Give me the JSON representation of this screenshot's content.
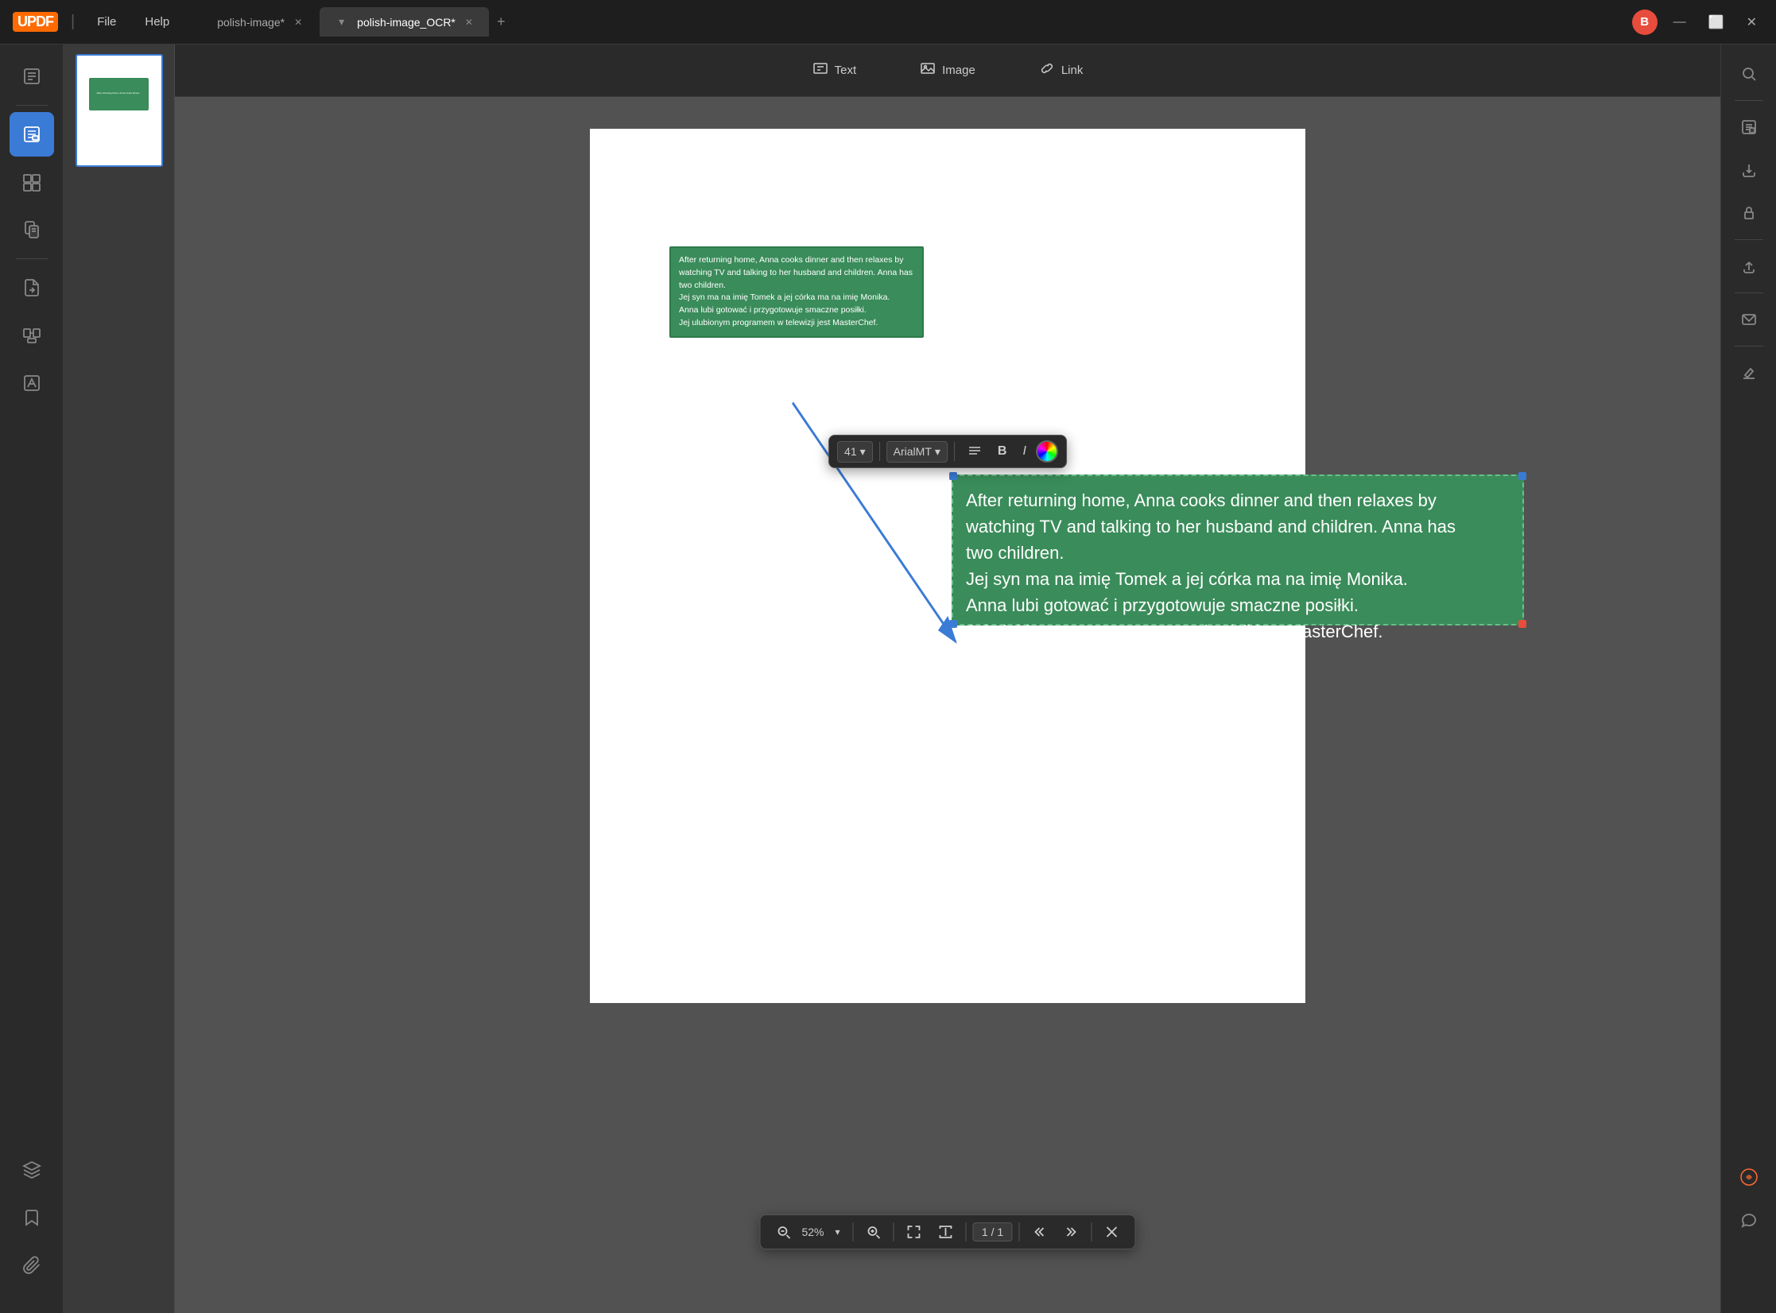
{
  "app": {
    "logo": "UPDF",
    "menus": [
      "File",
      "Help"
    ]
  },
  "tabs": [
    {
      "id": "tab1",
      "label": "polish-image*",
      "active": false
    },
    {
      "id": "tab2",
      "label": "polish-image_OCR*",
      "active": true
    }
  ],
  "tab_add_label": "+",
  "titlebar": {
    "minimize": "—",
    "maximize": "⬜",
    "close": "✕"
  },
  "toolbar": {
    "text_label": "Text",
    "image_label": "Image",
    "link_label": "Link"
  },
  "preview_text": {
    "line1": "After returning home, Anna cooks dinner and then relaxes by",
    "line2": "watching TV and talking to her husband and children. Anna has",
    "line3": "two children.",
    "line4": "Jej syn ma na imię Tomek a jej córka ma na imię Monika.",
    "line5": "Anna lubi gotować i przygotowuje smaczne posiłki.",
    "line6": "Jej ulubionym programem w telewizji jest MasterChef."
  },
  "main_text": {
    "line1": "After returning home, Anna cooks dinner and then relaxes by",
    "line2": "watching TV and talking to her husband and children. Anna has",
    "line3": "two children.",
    "line4": "Jej syn ma na imię Tomek a jej córka ma na imię Monika.",
    "line5": "Anna lubi gotować i przygotowuje smaczne posiłki.",
    "line6": "Jej ulubionym programem w telewizji jest MasterChef."
  },
  "format_toolbar": {
    "font_size": "41",
    "font_name": "ArialMT",
    "align_icon": "≡",
    "bold_label": "B",
    "italic_label": "I"
  },
  "bottom_toolbar": {
    "zoom_level": "52%",
    "page_current": "1",
    "page_total": "1",
    "page_display": "1 / 1"
  },
  "sidebar_left": {
    "icons": [
      {
        "name": "reader-icon",
        "symbol": "📄",
        "active": false
      },
      {
        "name": "edit-icon",
        "symbol": "✏️",
        "active": true
      },
      {
        "name": "page-layout-icon",
        "symbol": "⊞",
        "active": false
      },
      {
        "name": "ocr-icon",
        "symbol": "⊡",
        "active": false
      },
      {
        "name": "extract-icon",
        "symbol": "↗",
        "active": false
      },
      {
        "name": "compress-icon",
        "symbol": "⊟",
        "active": false
      },
      {
        "name": "watermark-icon",
        "symbol": "◫",
        "active": false
      }
    ]
  },
  "sidebar_right": {
    "icons": [
      {
        "name": "search-icon",
        "symbol": "🔍"
      },
      {
        "name": "ocr-panel-icon",
        "symbol": "▦"
      },
      {
        "name": "import-icon",
        "symbol": "⬇"
      },
      {
        "name": "protect-icon",
        "symbol": "🔒"
      },
      {
        "name": "share-icon",
        "symbol": "↑"
      },
      {
        "name": "mail-icon",
        "symbol": "✉"
      },
      {
        "name": "sign-icon",
        "symbol": "✍"
      }
    ]
  },
  "colors": {
    "titlebar_bg": "#1e1e1e",
    "sidebar_bg": "#2a2a2a",
    "canvas_bg": "#525252",
    "text_box_bg": "#3a8c5a",
    "text_box_border": "#6bbf8a",
    "accent_blue": "#3a7bd5",
    "accent_red": "#e74c3c"
  }
}
